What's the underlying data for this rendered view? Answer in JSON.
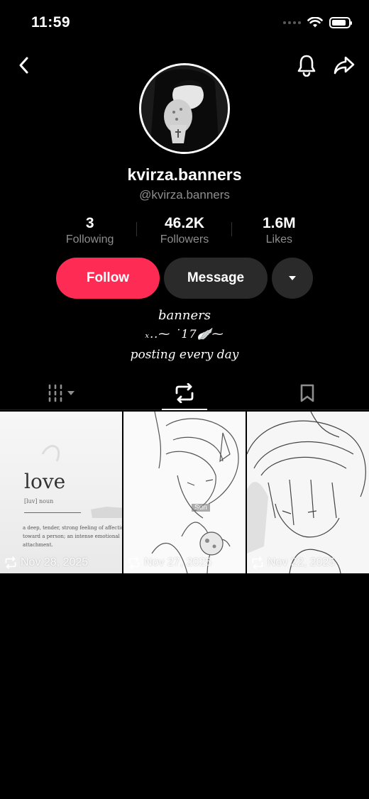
{
  "status_bar": {
    "time": "11:59",
    "battery_level": 0.85
  },
  "header": {
    "back_icon": "chevron-left-icon",
    "bell_icon": "bell-icon",
    "share_icon": "share-icon"
  },
  "profile": {
    "display_name": "kvirza.banners",
    "handle": "@kvirza.banners"
  },
  "stats": [
    {
      "value": "3",
      "label": "Following"
    },
    {
      "value": "46.2K",
      "label": "Followers"
    },
    {
      "value": "1.6M",
      "label": "Likes"
    }
  ],
  "actions": {
    "follow_label": "Follow",
    "message_label": "Message"
  },
  "bio": {
    "line1": "banners",
    "line2": "ₓ..⁓ ˙17🪽⁓",
    "line3": "posting every day"
  },
  "tabs": [
    {
      "icon": "grid-filter-icon",
      "active": false
    },
    {
      "icon": "repost-icon",
      "active": true
    },
    {
      "icon": "bookmark-icon",
      "active": false
    }
  ],
  "posts": [
    {
      "date": "Nov 28, 2025",
      "caption_word": "love",
      "caption_phonetic": "[luv] noun",
      "caption_definition": "a deep, tender, strong feeling of affection toward a person; an intense emotional attachment."
    },
    {
      "date": "Nov 27, 2025",
      "caption_label": "Sun"
    },
    {
      "date": "Nov 22, 2025"
    }
  ],
  "colors": {
    "accent": "#fe2c55",
    "secondary_button": "#2a2a2a",
    "muted_text": "#8e8e8e",
    "background": "#000000"
  }
}
